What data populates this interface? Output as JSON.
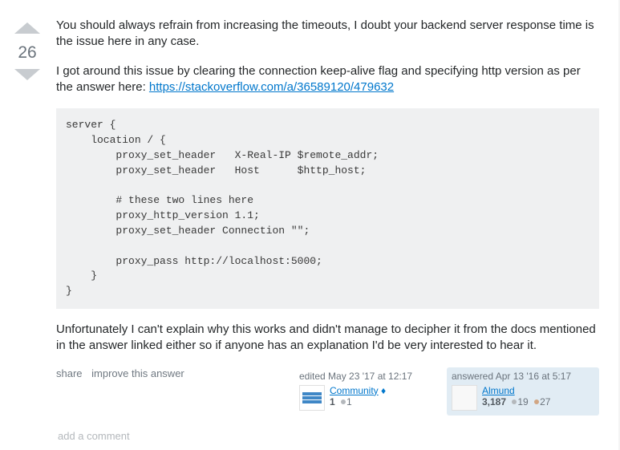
{
  "vote": {
    "count": "26"
  },
  "body": {
    "p1": "You should always refrain from increasing the timeouts, I doubt your backend server response time is the issue here in any case.",
    "p2a": "I got around this issue by clearing the connection keep-alive flag and specifying http version as per the answer here: ",
    "p2_link_text": "https://stackoverflow.com/a/36589120/479632",
    "code": "server {\n    location / {\n        proxy_set_header   X-Real-IP $remote_addr;\n        proxy_set_header   Host      $http_host;\n\n        # these two lines here\n        proxy_http_version 1.1;\n        proxy_set_header Connection \"\";\n\n        proxy_pass http://localhost:5000;\n    }\n}",
    "p3": "Unfortunately I can't explain why this works and didn't manage to decipher it from the docs mentioned in the answer linked either so if anyone has an explanation I'd be very interested to hear it."
  },
  "actions": {
    "share": "share",
    "improve": "improve this answer"
  },
  "editor": {
    "time_label": "edited May 23 '17 at 12:17",
    "name": "Community",
    "diamond": "♦",
    "rep": "1",
    "silver": "1"
  },
  "author": {
    "time_label": "answered Apr 13 '16 at 5:17",
    "name": "Almund",
    "rep": "3,187",
    "silver": "19",
    "bronze": "27"
  },
  "comments": {
    "add": "add a comment"
  }
}
